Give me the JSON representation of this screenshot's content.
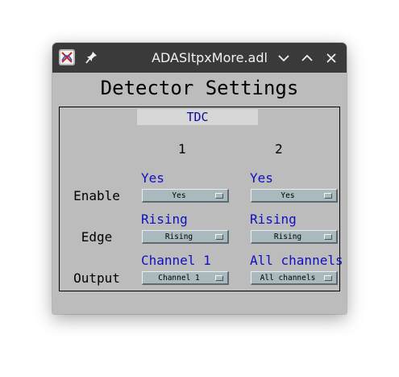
{
  "window": {
    "title": "ADASItpxMore.adl"
  },
  "panel": {
    "heading": "Detector Settings",
    "group_label": "TDC",
    "columns": [
      "1",
      "2"
    ],
    "rows": [
      {
        "label": "Enable",
        "cells": [
          {
            "readback": "Yes",
            "menu": "Yes"
          },
          {
            "readback": "Yes",
            "menu": "Yes"
          }
        ]
      },
      {
        "label": "Edge",
        "cells": [
          {
            "readback": "Rising",
            "menu": "Rising"
          },
          {
            "readback": "Rising",
            "menu": "Rising"
          }
        ]
      },
      {
        "label": "Output",
        "cells": [
          {
            "readback": "Channel 1",
            "menu": "Channel 1"
          },
          {
            "readback": "All channels",
            "menu": "All channels"
          }
        ]
      }
    ]
  },
  "icons": [
    "app-icon",
    "pin-icon",
    "minimize-icon",
    "maximize-icon",
    "close-icon"
  ],
  "colors": {
    "background": "#bcbcbc",
    "readback": "#1010c0",
    "menu": "#a9b9be",
    "titlebar": "#3a3a3a"
  }
}
